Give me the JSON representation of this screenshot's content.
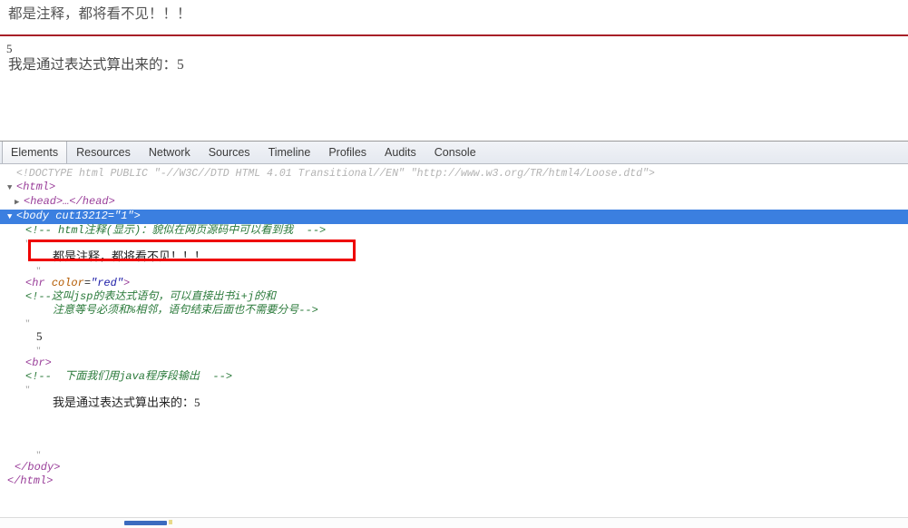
{
  "page_render": {
    "heading": "都是注释，都将看不见！！！",
    "rule_color": "#a81f27",
    "number_output": "5",
    "expression_output": "我是通过表达式算出来的：5"
  },
  "devtools": {
    "tabs": [
      {
        "label": "Elements",
        "selected": true
      },
      {
        "label": "Resources",
        "selected": false
      },
      {
        "label": "Network",
        "selected": false
      },
      {
        "label": "Sources",
        "selected": false
      },
      {
        "label": "Timeline",
        "selected": false
      },
      {
        "label": "Profiles",
        "selected": false
      },
      {
        "label": "Audits",
        "selected": false
      },
      {
        "label": "Console",
        "selected": false
      }
    ],
    "dom": {
      "doctype": "<!DOCTYPE html PUBLIC \"-//W3C//DTD HTML 4.01 Transitional//EN\" \"http://www.w3.org/TR/html4/Loose.dtd\">",
      "html_open": "<html>",
      "head_collapsed": "<head>…</head>",
      "body_open_tag": "<body",
      "body_attr_name": "cut13212",
      "body_attr_value": "\"1\"",
      "body_close_bracket": ">",
      "html_comment": "<!-- html注释(显示)：貌似在网页源码中可以看到我  -->",
      "text_node_1": "都是注释，都将看不见！！！",
      "hr_tag_open": "<hr",
      "hr_attr_name": "color",
      "hr_attr_value": "\"red\"",
      "hr_tag_close": ">",
      "jsp_comment_line1": "<!--这叫jsp的表达式语句，可以直接出书i+j的和",
      "jsp_comment_line2": "注意等号必须和%相邻，语句结束后面也不需要分号-->",
      "text_node_number": "5",
      "br_tag": "<br>",
      "java_comment": "<!--  下面我们用java程序段输出  -->",
      "text_node_expr": "我是通过表达式算出来的：5",
      "body_close": "</body>",
      "html_close": "</html>",
      "quote_mark": "\""
    },
    "annotation": {
      "color": "#ee0000",
      "targets_comment": "<!-- html注释(显示)：貌似在网页源码中可以看到我  -->"
    },
    "scrollbar": {
      "thumb_color": "#3b6bbf",
      "tick_color": "#e8d98a"
    }
  }
}
